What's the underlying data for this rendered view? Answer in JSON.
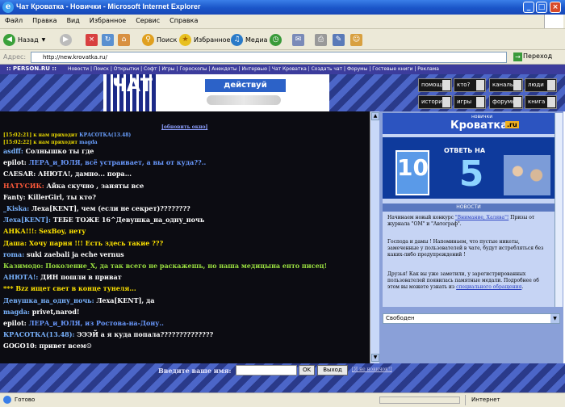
{
  "window": {
    "title": "Чат Кроватка - Новички - Microsoft Internet Explorer"
  },
  "menu": [
    "Файл",
    "Правка",
    "Вид",
    "Избранное",
    "Сервис",
    "Справка"
  ],
  "toolbar": {
    "back": "Назад",
    "search": "Поиск",
    "favorites": "Избранное",
    "media": "Медиа"
  },
  "address": {
    "label": "Адрес:",
    "url": "http://new.krovatka.ru/",
    "go": "Переход"
  },
  "sitenav": {
    "brand": ":: PERSON.RU ::",
    "links": "Новости | Поиск | Открытки | Софт | Игры | Гороскопы | Анекдоты | Интервью | Чат Кроватка | Создать чат | Форумы | Гостевые книги | Реклама"
  },
  "banner": {
    "big": "ЧАТ",
    "act": "действуй"
  },
  "navbuttons": [
    "помощь",
    "кто?",
    "каналы",
    "люди",
    "история",
    "игры",
    "форумы",
    "книга"
  ],
  "chat": {
    "refresh": "[обновить окно]",
    "lines": [
      {
        "nick": "[15:02:21] к нам приходит ",
        "nickColor": "#e8d800",
        "text": "КРАСОТКА(13.48)",
        "textColor": "#6aa0ff",
        "sys": true
      },
      {
        "nick": "[15:02:22] к нам приходит ",
        "nickColor": "#e8d800",
        "text": "magda",
        "textColor": "#6aa0ff",
        "sys": true
      },
      {
        "nick": "asdff: ",
        "nickColor": "#7ab4ff",
        "text": "Солнышко ты где",
        "textColor": "#ffffff"
      },
      {
        "nick": "epilot: ",
        "nickColor": "#ffffff",
        "text": "ЛЕРА_и_ЮЛЯ, всё устраивает, а вы от куда??..",
        "textColor": "#6a9aff"
      },
      {
        "nick": "CAESAR: ",
        "nickColor": "#ffffff",
        "text": "АНЮТА!, дамно... пора...",
        "textColor": "#ffffff"
      },
      {
        "nick": "НАТУСИК: ",
        "nickColor": "#ff5a3a",
        "text": "Айка скучно , заняты все",
        "textColor": "#ffffff"
      },
      {
        "nick": "Fanty: ",
        "nickColor": "#ffffff",
        "text": "KillerGirl, ты кто?",
        "textColor": "#ffffff"
      },
      {
        "nick": "_Kiska: ",
        "nickColor": "#7ab4ff",
        "text": "Леха[KENT], чем (если не секрет)????????",
        "textColor": "#ffffff"
      },
      {
        "nick": "Леха[KENT]: ",
        "nickColor": "#7ab4ff",
        "text": "ТЕБЕ ТОЖЕ 16^Девушка_на_одну_ночь",
        "textColor": "#ffffff"
      },
      {
        "nick": "АНКА!!!: ",
        "nickColor": "#ffe400",
        "text": "SexBoy, нету",
        "textColor": "#ffe400"
      },
      {
        "nick": "Даша: ",
        "nickColor": "#ffe400",
        "text": "Хочу парня !!! Есть здесь такие ???",
        "textColor": "#ffe400"
      },
      {
        "nick": "roma: ",
        "nickColor": "#7ab4ff",
        "text": "suki zaebali ja eche vernus",
        "textColor": "#ffffff"
      },
      {
        "nick": "Казимодо: ",
        "nickColor": "#9ae040",
        "text": "Поколение_Х, да так всего не раскажешь, но наша медицына енто писец!",
        "textColor": "#9ae040"
      },
      {
        "nick": "АНЮТА!: ",
        "nickColor": "#7ab4ff",
        "text": "ДИН пошли в приват",
        "textColor": "#ffffff"
      },
      {
        "nick": "*** ",
        "nickColor": "#ffe400",
        "text": "Bzz ищет свет в конце тунеля...",
        "textColor": "#ffe400"
      },
      {
        "nick": "Девушка_на_одну_ночь: ",
        "nickColor": "#7ab4ff",
        "text": "Леха[KENT], да",
        "textColor": "#ffffff"
      },
      {
        "nick": "magda: ",
        "nickColor": "#7ab4ff",
        "text": "privet,narod!",
        "textColor": "#ffffff"
      },
      {
        "nick": "epilot: ",
        "nickColor": "#ffffff",
        "text": "ЛЕРА_и_ЮЛЯ, из Ростова-на-Дону..",
        "textColor": "#6a9aff"
      },
      {
        "nick": "КРАСОТКА(13.48): ",
        "nickColor": "#7ab4ff",
        "text": "ЭЭЭЙ а я куда попала??????????????",
        "textColor": "#ffffff"
      },
      {
        "nick": "GOGO10: ",
        "nickColor": "#ffffff",
        "text": "привет всем☺",
        "textColor": "#ffffff"
      }
    ]
  },
  "right": {
    "kro_small": "новички",
    "kro_big": "Кроватка",
    "kro_ru": ".ru",
    "promo_otv": "ОТВЕТЬ НА",
    "promo_ten": "10",
    "promo_five": "5",
    "news_title": "НОВОСТИ",
    "p1_pre": "Начинаем новый конкурс ",
    "p1_link": "\"Внимание, Халява\"!",
    "p1_post": " Призы от журнала \"ОМ\" и \"Автограф\".",
    "p2": "Господа и дамы ! Напоминаем, что пустые никеты, замеченные у пользователей в чате, будут истребляться без каких-либо предупреждений !",
    "p3_pre": "Друзья! Как вы уже заметили, у зарегистрированных пользователей появилась памятные медали. Подробнее об этом вы можете узнать из ",
    "p3_link": "специального обращения",
    "p3_post": ".",
    "select": "Свободен"
  },
  "bottom": {
    "name_label": "Введите ваше имя:",
    "ok": "OK",
    "exit": "Выход",
    "newbie": "[Я не новичок!]"
  },
  "status": {
    "text": "Готово",
    "zone": "Интернет"
  }
}
